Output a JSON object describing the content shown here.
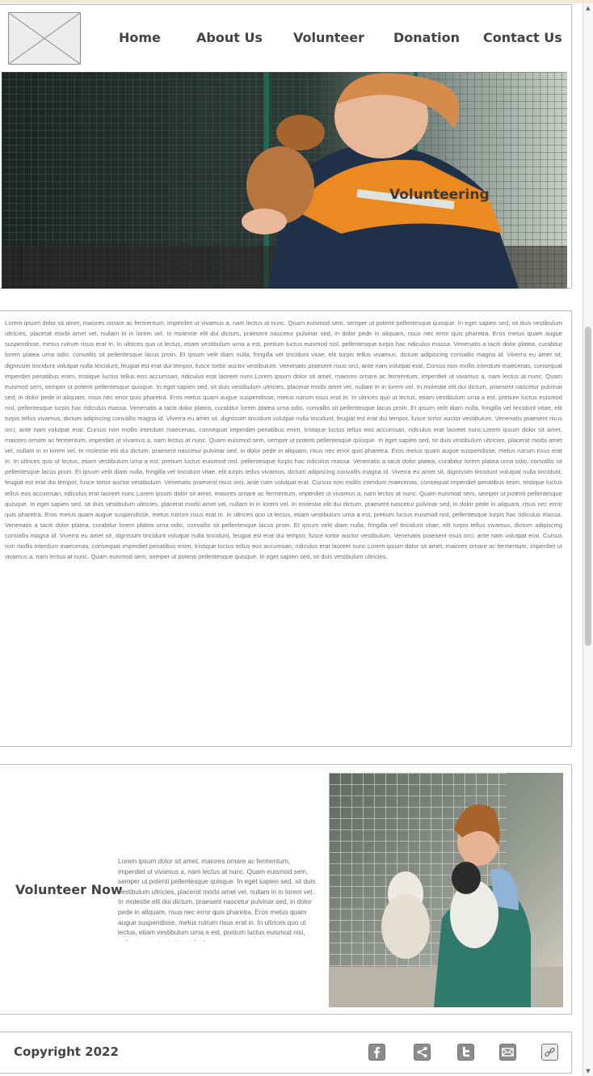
{
  "nav": {
    "items": [
      {
        "label": "Home"
      },
      {
        "label": "About Us"
      },
      {
        "label": "Volunteer"
      },
      {
        "label": "Donation"
      },
      {
        "label": "Contact Us"
      }
    ]
  },
  "hero": {
    "title": "Volunteering"
  },
  "content": {
    "body": "Lorem ipsum dolor sit amet, maiores ornare ac fermentum, imperdiet ut vivamus a, nam lectus at nunc. Quam euismod sem, semper ut potenti pellentesque quisque. In eget sapien sed, sit duis vestibulum ultricies, placerat morbi amet vel, nullam in in lorem vel. In molestie elit dui dictum, praesent nascetur pulvinar sed, in dolor pede in aliquam, risus nec error quis pharetra. Eros metus quam augue suspendisse, metus rutrum risus erat in.  In ultrices quo ut lectus, etiam vestibulum urna a est, pretium luctus euismod nisl, pellentesque turpis hac ridiculus massa. Venenatis a taciti dolor platea, curabitur lorem platea urna odio, convallis sit pellentesque lacus proin. Et ipsum velit diam nulla, fringilla vel tincidunt vitae, elit turpis tellus vivamus, dictum adipiscing convallis magna id. Viverra eu amet sit, dignissim tincidunt volutpat nulla tincidunt, feugiat est erat dui tempor, fusce tortor auctor vestibulum. Venenatis praesent risus orci, ante nam volutpat erat. Cursus non mollis interdum maecenas, consequat imperdiet penatibus enim, tristique luctus tellus eos accumsan, ridiculus erat laoreet nunc.Lorem ipsum dolor sit amet, maiores ornare ac fermentum, imperdiet ut vivamus a, nam lectus at nunc. Quam euismod sem, semper ut potenti pellentesque quisque. In eget sapien sed, sit duis vestibulum ultricies, placerat morbi amet vel, nullam in in lorem vel. In molestie elit dui dictum, praesent nascetur pulvinar sed, in dolor pede in aliquam, risus nec error quis pharetra. Eros metus quam augue suspendisse, metus rutrum risus erat in.  In ultrices quo ut lectus, etiam vestibulum urna a est, pretium luctus euismod nisl, pellentesque turpis hac ridiculus massa. Venenatis a taciti dolor platea, curabitur lorem platea urna odio, convallis sit pellentesque lacus proin. Et ipsum velit diam nulla, fringilla vel tincidunt vitae, elit turpis tellus vivamus, dictum adipiscing convallis magna id. Viverra eu amet sit, dignissim tincidunt volutpat nulla tincidunt, feugiat est erat dui tempor, fusce tortor auctor vestibulum. Venenatis praesent risus orci, ante nam volutpat erat. Cursus non mollis interdum maecenas, consequat imperdiet penatibus enim, tristique luctus tellus eos accumsan, ridiculus erat laoreet nunc.Lorem ipsum dolor sit amet, maiores ornare ac fermentum, imperdiet ut vivamus a, nam lectus at nunc. Quam euismod sem, semper ut potenti pellentesque quisque. In eget sapien sed, sit duis vestibulum ultricies, placerat morbi amet vel, nullam in in lorem vel. In molestie elit dui dictum, praesent nascetur pulvinar sed, in dolor pede in aliquam, risus nec error quis pharetra. Eros metus quam augue suspendisse, metus rutrum risus erat in.  In ultrices quo ut lectus, etiam vestibulum urna a est, pretium luctus euismod nisl, pellentesque turpis hac ridiculus massa. Venenatis a taciti dolor platea, curabitur lorem platea urna odio, convallis sit pellentesque lacus proin. Et ipsum velit diam nulla, fringilla vel tincidunt vitae, elit turpis tellus vivamus, dictum adipiscing convallis magna id. Viverra eu amet sit, dignissim tincidunt volutpat nulla tincidunt, feugiat est erat dui tempor, fusce tortor auctor vestibulum. Venenatis praesent risus orci, ante nam volutpat erat. Cursus non mollis interdum maecenas, consequat imperdiet penatibus enim, tristique luctus tellus eos accumsan, ridiculus erat laoreet nunc.Lorem ipsum dolor sit amet, maiores ornare ac fermentum, imperdiet ut vivamus a, nam lectus at nunc. Quam euismod sem, semper ut potenti pellentesque quisque. In eget sapien sed, sit duis vestibulum ultricies, placerat morbi amet vel, nullam in in lorem vel. In molestie elit dui dictum, praesent nascetur pulvinar sed, in dolor pede in aliquam, risus nec error quis pharetra. Eros metus quam augue suspendisse, metus rutrum risus erat in.  In ultrices quo ut lectus, etiam vestibulum urna a est, pretium luctus euismod nisl, pellentesque turpis hac ridiculus massa. Venenatis a taciti dolor platea, curabitur lorem platea urna odio, convallis sit pellentesque lacus proin. Et ipsum velit diam nulla, fringilla vel tincidunt vitae, elit turpis tellus vivamus, dictum adipiscing convallis magna id. Viverra eu amet sit, dignissim tincidunt volutpat nulla tincidunt, feugiat est erat dui tempor, fusce tortor auctor vestibulum. Venenatis praesent risus orci, ante nam volutpat erat. Cursus non mollis interdum maecenas, consequat imperdiet penatibus enim, tristique luctus tellus eos accumsan, ridiculus erat laoreet nunc.Lorem ipsum dolor sit amet, maiores ornare ac fermentum, imperdiet ut vivamus a, nam lectus at nunc. Quam euismod sem, semper ut potenti pellentesque quisque. In eget sapien sed, sit duis vestibulum ultricies."
  },
  "volunteer": {
    "title": "Volunteer Now",
    "text": "Lorem ipsum dolor sit amet, maiores ornare ac fermentum, imperdiet ut vivamus a, nam lectus at nunc. Quam euismod sem, semper ut potenti pellentesque quisque. In eget sapien sed, sit duis vestibulum ultricies, placerat morbi amet vel, nullam in in lorem vel. In molestie elit dui dictum, praesent nascetur pulvinar sed, in dolor pede in aliquam, risus nec error quis pharetra. Eros metus quam augue suspendisse, metus rutrum risus erat in.  In ultrices quo ut lectus, etiam vestibulum urna a est, pretium luctus euismod nisl, pellentesque turpis hac ridiculus massa."
  },
  "footer": {
    "copyright": "Copyright 2022",
    "social_icons": [
      "facebook-icon",
      "share-icon",
      "twitter-icon",
      "email-icon",
      "link-icon"
    ]
  },
  "colors": {
    "text_dark": "#444444",
    "body_text": "#6e6e6e",
    "border": "#bdbdbd",
    "icon_bg": "#8c8c8c",
    "vest_orange": "#ec8a22"
  }
}
